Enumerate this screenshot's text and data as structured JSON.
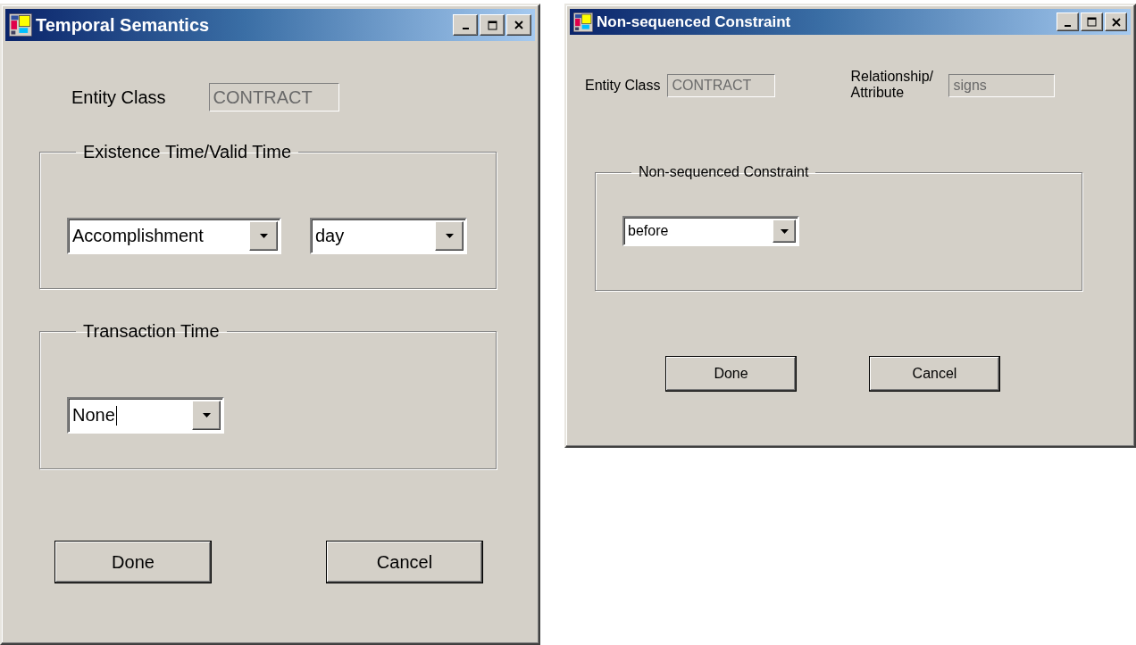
{
  "temporal_semantics_window": {
    "title": "Temporal Semantics",
    "entity_class": {
      "label": "Entity Class",
      "value": "CONTRACT",
      "disabled": true
    },
    "groups": [
      {
        "title": "Existence Time/Valid Time",
        "dropdowns": [
          {
            "value": "Accomplishment",
            "focused": false
          },
          {
            "value": "day",
            "focused": false
          }
        ]
      },
      {
        "title": "Transaction Time",
        "dropdowns": [
          {
            "value": "None",
            "focused": true
          }
        ]
      }
    ],
    "buttons": [
      "Done",
      "Cancel"
    ]
  },
  "non_sequenced_constraint_window": {
    "title": "Non-sequenced Constraint",
    "fields": [
      {
        "label": "Entity Class",
        "value": "CONTRACT",
        "disabled": true
      },
      {
        "label": "Relationship/ Attribute",
        "value": "signs",
        "disabled": true
      }
    ],
    "group": {
      "title": "Non-sequenced Constraint",
      "dropdowns": [
        {
          "value": "before",
          "focused": false
        }
      ]
    },
    "buttons": [
      "Done",
      "Cancel"
    ]
  }
}
